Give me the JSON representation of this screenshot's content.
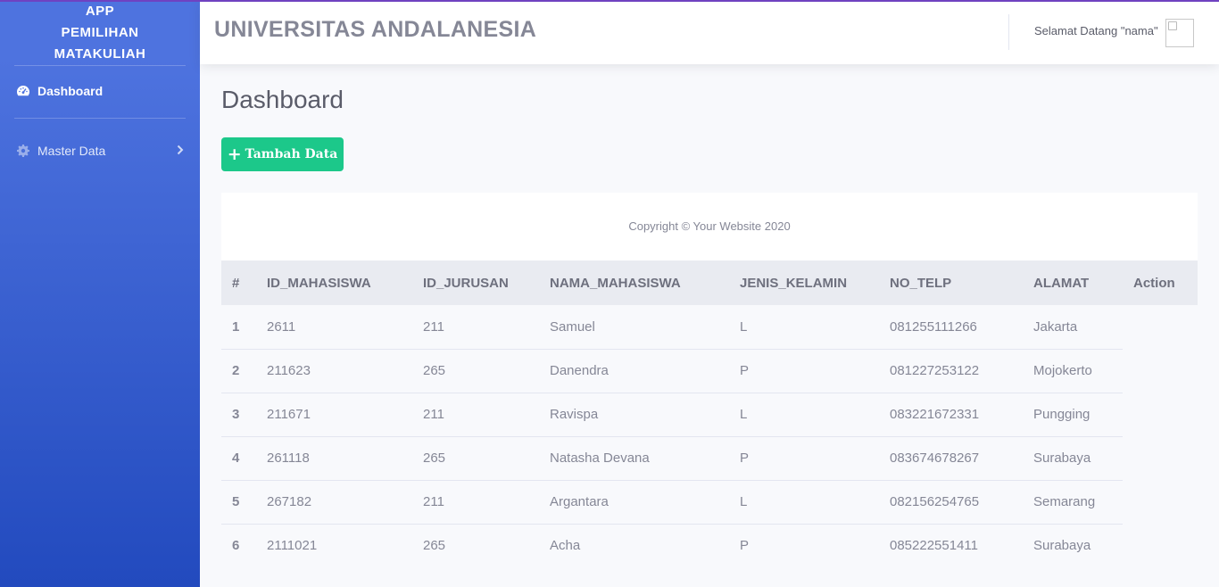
{
  "app": {
    "brand_line1": "APP",
    "brand_line2": "PEMILIHAN",
    "brand_line3": "MATAKULIAH"
  },
  "sidebar": {
    "items": [
      {
        "label": "Dashboard",
        "icon": "tachometer-icon",
        "active": true
      },
      {
        "label": "Master Data",
        "icon": "cog-icon",
        "active": false
      }
    ]
  },
  "topbar": {
    "site_title": "UNIVERSITAS ANDALANESIA",
    "welcome": "Selamat Datang \"nama\""
  },
  "main": {
    "page_title": "Dashboard",
    "add_button": "Tambah Data",
    "copyright": "Copyright © Your Website 2020"
  },
  "table": {
    "headers": [
      "#",
      "ID_MAHASISWA",
      "ID_JURUSAN",
      "NAMA_MAHASISWA",
      "JENIS_KELAMIN",
      "NO_TELP",
      "ALAMAT",
      "Action"
    ],
    "rows": [
      [
        "1",
        "2611",
        "211",
        "Samuel",
        "L",
        "081255111266",
        "Jakarta"
      ],
      [
        "2",
        "211623",
        "265",
        "Danendra",
        "P",
        "081227253122",
        "Mojokerto"
      ],
      [
        "3",
        "211671",
        "211",
        "Ravispa",
        "L",
        "083221672331",
        "Pungging"
      ],
      [
        "4",
        "261118",
        "265",
        "Natasha Devana",
        "P",
        "083674678267",
        "Surabaya"
      ],
      [
        "5",
        "267182",
        "211",
        "Argantara",
        "L",
        "082156254765",
        "Semarang"
      ],
      [
        "6",
        "2111021",
        "265",
        "Acha",
        "P",
        "085222551411",
        "Surabaya"
      ]
    ]
  },
  "colors": {
    "sidebar_top": "#4e73df",
    "sidebar_bottom": "#224abe",
    "success": "#1cc88a",
    "text_muted": "#858796"
  }
}
